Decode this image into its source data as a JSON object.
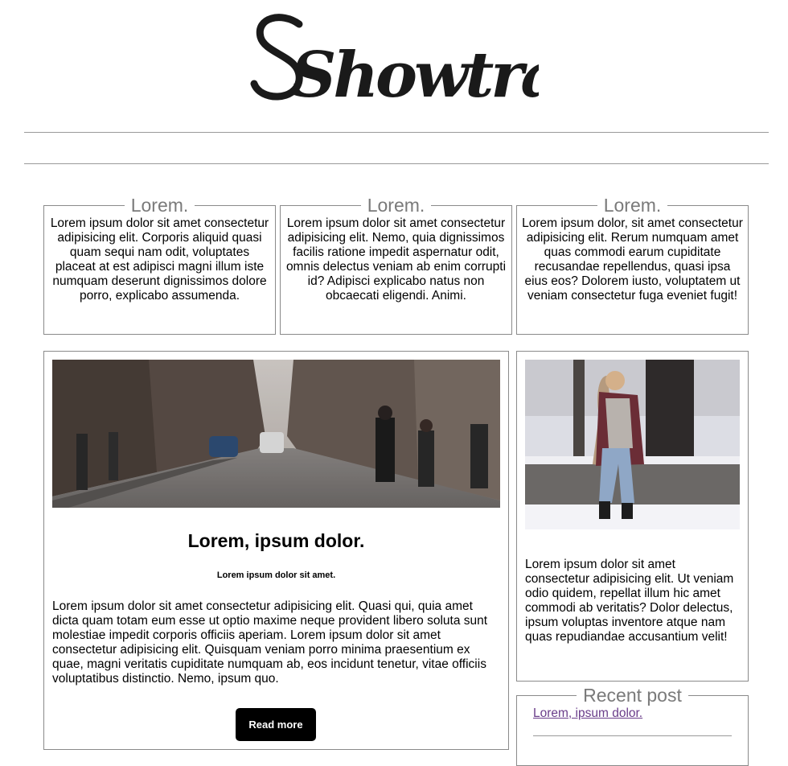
{
  "brand": {
    "logo_text": "Showtrack"
  },
  "features": [
    {
      "title": "Lorem.",
      "text": "Lorem ipsum dolor sit amet consectetur adipisicing elit. Corporis aliquid quasi quam sequi nam odit, voluptates placeat at est adipisci magni illum iste numquam deserunt dignissimos dolore porro, explicabo assumenda."
    },
    {
      "title": "Lorem.",
      "text": "Lorem ipsum dolor sit amet consectetur adipisicing elit. Nemo, quia dignissimos facilis ratione impedit aspernatur odit, omnis delectus veniam ab enim corrupti id? Adipisci explicabo natus non obcaecati eligendi. Animi."
    },
    {
      "title": "Lorem.",
      "text": "Lorem ipsum dolor, sit amet consectetur adipisicing elit. Rerum numquam amet quas commodi earum cupiditate recusandae repellendus, quasi ipsa eius eos? Dolorem iusto, voluptatem ut veniam consectetur fuga eveniet fugit!"
    }
  ],
  "main_post": {
    "title": "Lorem, ipsum dolor.",
    "subtitle": "Lorem ipsum dolor sit amet.",
    "body": "Lorem ipsum dolor sit amet consectetur adipisicing elit. Quasi qui, quia amet dicta quam totam eum esse ut optio maxime neque provident libero soluta sunt molestiae impedit corporis officiis aperiam. Lorem ipsum dolor sit amet consectetur adipisicing elit. Quisquam veniam porro minima praesentium ex quae, magni veritatis cupiditate numquam ab, eos incidunt tenetur, vitae officiis voluptatibus distinctio. Nemo, ipsum quo.",
    "read_more_label": "Read more"
  },
  "side_post": {
    "body": "Lorem ipsum dolor sit amet consectetur adipisicing elit. Ut veniam odio quidem, repellat illum hic amet commodi ab veritatis? Dolor delectus, ipsum voluptas inventore atque nam quas repudiandae accusantium velit!"
  },
  "recent": {
    "title": "Recent post",
    "links": [
      "Lorem, ipsum dolor."
    ]
  },
  "colors": {
    "border": "#8a8a8a",
    "legend": "#7a7a7a",
    "link_visited": "#6a3d8a",
    "button_bg": "#000000"
  }
}
